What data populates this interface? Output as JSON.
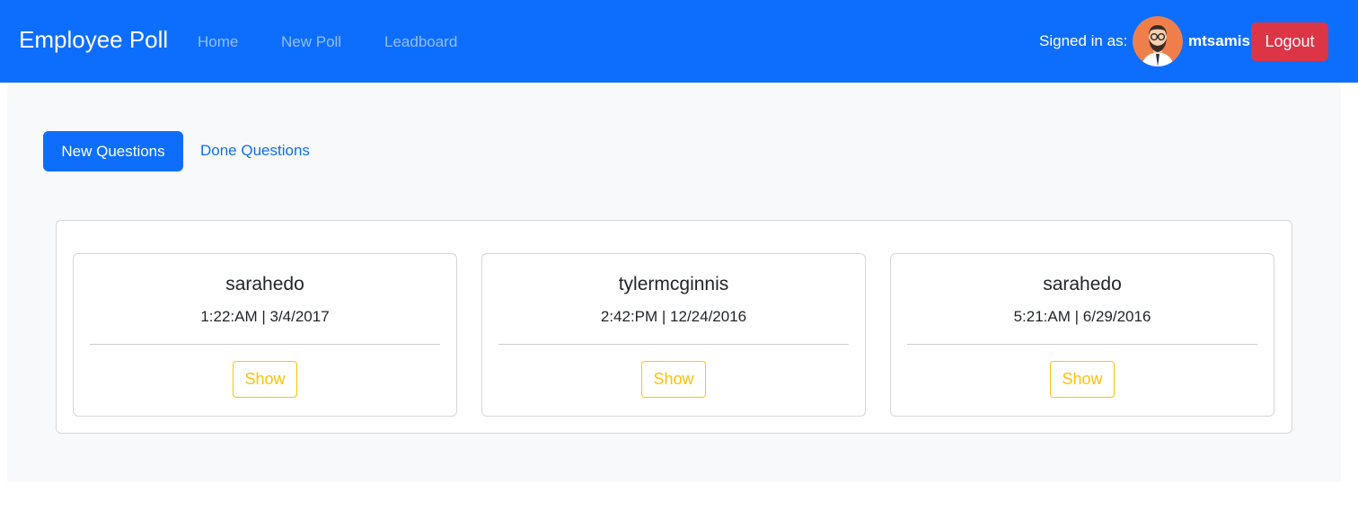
{
  "navbar": {
    "brand": "Employee Poll",
    "links": [
      {
        "label": "Home"
      },
      {
        "label": "New Poll"
      },
      {
        "label": "Leadboard"
      }
    ],
    "signed_in_label": "Signed in as:",
    "username": "mtsamis",
    "logout_label": "Logout",
    "avatar_icon": "bearded-man-avatar",
    "color": "#0d6efd"
  },
  "tabs": {
    "active_label": "New Questions",
    "inactive_label": "Done Questions"
  },
  "questions": [
    {
      "author": "sarahedo",
      "timestamp": "1:22:AM | 3/4/2017",
      "button_label": "Show"
    },
    {
      "author": "tylermcginnis",
      "timestamp": "2:42:PM | 12/24/2016",
      "button_label": "Show"
    },
    {
      "author": "sarahedo",
      "timestamp": "5:21:AM | 6/29/2016",
      "button_label": "Show"
    }
  ],
  "colors": {
    "primary": "#0d6efd",
    "danger": "#dc3545",
    "warning": "#ffc107",
    "background": "#f8f9fa"
  }
}
